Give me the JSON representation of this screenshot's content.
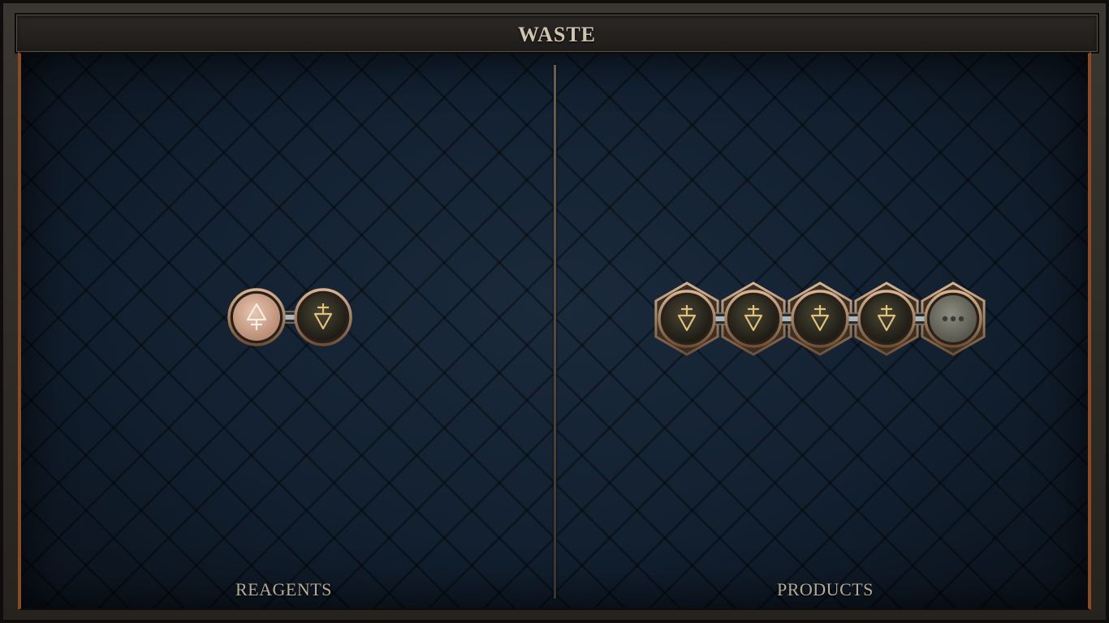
{
  "window": {
    "title": "WASTE"
  },
  "panels": {
    "reagents": {
      "label": "REAGENTS"
    },
    "products": {
      "label": "PRODUCTS"
    }
  },
  "reagents": {
    "atoms": [
      {
        "symbol": "air-element-icon",
        "style": "pale-copper"
      },
      {
        "symbol": "earth-element-icon",
        "style": "dark-bronze"
      }
    ]
  },
  "products": {
    "atoms": [
      {
        "symbol": "earth-element-icon",
        "style": "dark-bronze"
      },
      {
        "symbol": "earth-element-icon",
        "style": "dark-bronze"
      },
      {
        "symbol": "earth-element-icon",
        "style": "dark-bronze"
      },
      {
        "symbol": "earth-element-icon",
        "style": "dark-bronze"
      },
      {
        "symbol": "more-icon",
        "style": "grey"
      }
    ]
  },
  "colors": {
    "title_text": "#cfc4b0",
    "label_text": "#b7ab98",
    "board_bg": "#122030",
    "accent_copper": "#8a4a22",
    "glyph_gold": "#e2c27a"
  }
}
